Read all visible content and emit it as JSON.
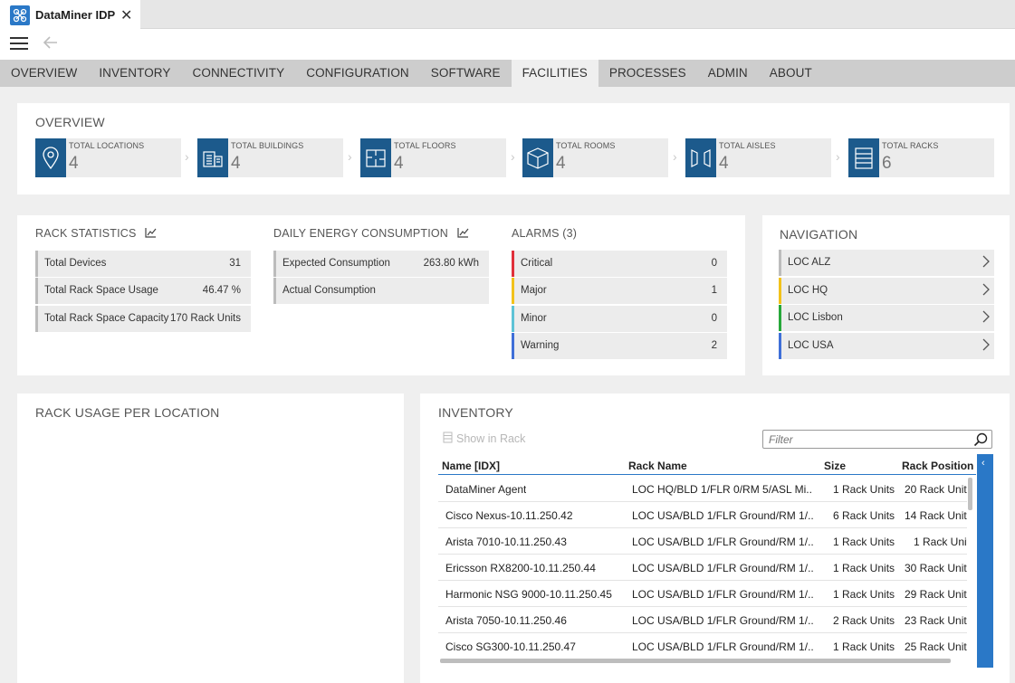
{
  "window": {
    "title": "DataMiner IDP"
  },
  "nav": {
    "tabs": [
      {
        "label": "OVERVIEW"
      },
      {
        "label": "INVENTORY"
      },
      {
        "label": "CONNECTIVITY"
      },
      {
        "label": "CONFIGURATION"
      },
      {
        "label": "SOFTWARE"
      },
      {
        "label": "FACILITIES",
        "active": true
      },
      {
        "label": "PROCESSES"
      },
      {
        "label": "ADMIN"
      },
      {
        "label": "ABOUT"
      }
    ]
  },
  "overview": {
    "title": "OVERVIEW",
    "cards": [
      {
        "label": "TOTAL LOCATIONS",
        "value": "4",
        "icon": "location-pin-icon"
      },
      {
        "label": "TOTAL BUILDINGS",
        "value": "4",
        "icon": "building-icon"
      },
      {
        "label": "TOTAL FLOORS",
        "value": "4",
        "icon": "floor-plan-icon"
      },
      {
        "label": "TOTAL ROOMS",
        "value": "4",
        "icon": "room-cube-icon"
      },
      {
        "label": "TOTAL AISLES",
        "value": "4",
        "icon": "aisle-icon"
      },
      {
        "label": "TOTAL RACKS",
        "value": "6",
        "icon": "rack-icon"
      }
    ]
  },
  "rack_statistics": {
    "title": "RACK STATISTICS",
    "rows": [
      {
        "label": "Total Devices",
        "value": "31"
      },
      {
        "label": "Total Rack Space Usage",
        "value": "46.47 %"
      },
      {
        "label": "Total Rack Space Capacity",
        "value": "170 Rack Units"
      }
    ]
  },
  "energy": {
    "title": "DAILY ENERGY CONSUMPTION",
    "rows": [
      {
        "label": "Expected Consumption",
        "value": "263.80 kWh"
      },
      {
        "label": "Actual Consumption",
        "value": ""
      }
    ]
  },
  "alarms": {
    "title": "ALARMS (3)",
    "rows": [
      {
        "label": "Critical",
        "value": "0",
        "color": "#e0303a"
      },
      {
        "label": "Major",
        "value": "1",
        "color": "#f2c21b"
      },
      {
        "label": "Minor",
        "value": "0",
        "color": "#5ec3d6"
      },
      {
        "label": "Warning",
        "value": "2",
        "color": "#3f6fd8"
      }
    ]
  },
  "navigation": {
    "title": "NAVIGATION",
    "items": [
      {
        "label": "LOC ALZ",
        "color": "#bcbcbc"
      },
      {
        "label": "LOC HQ",
        "color": "#f2c21b"
      },
      {
        "label": "LOC Lisbon",
        "color": "#27a83a"
      },
      {
        "label": "LOC USA",
        "color": "#3f6fd8"
      }
    ]
  },
  "rack_usage": {
    "title": "RACK USAGE PER LOCATION"
  },
  "inventory": {
    "title": "INVENTORY",
    "show_in_rack_label": "Show in Rack",
    "filter_placeholder": "Filter",
    "columns": [
      "Name [IDX]",
      "Rack Name",
      "Size",
      "Rack Position"
    ],
    "rows": [
      [
        "DataMiner Agent",
        "LOC HQ/BLD 1/FLR 0/RM 5/ASL Mi...",
        "1 Rack Units",
        "20 Rack Unit"
      ],
      [
        "Cisco Nexus-10.11.250.42",
        "LOC USA/BLD 1/FLR Ground/RM 1/...",
        "6 Rack Units",
        "14 Rack Unit"
      ],
      [
        "Arista 7010-10.11.250.43",
        "LOC USA/BLD 1/FLR Ground/RM 1/...",
        "1 Rack Units",
        "1 Rack Unit"
      ],
      [
        "Ericsson RX8200-10.11.250.44",
        "LOC USA/BLD 1/FLR Ground/RM 1/...",
        "1 Rack Units",
        "30 Rack Unit"
      ],
      [
        "Harmonic NSG 9000-10.11.250.45",
        "LOC USA/BLD 1/FLR Ground/RM 1/...",
        "1 Rack Units",
        "29 Rack Unit"
      ],
      [
        "Arista 7050-10.11.250.46",
        "LOC USA/BLD 1/FLR Ground/RM 1/...",
        "2 Rack Units",
        "23 Rack Unit"
      ],
      [
        "Cisco SG300-10.11.250.47",
        "LOC USA/BLD 1/FLR Ground/RM 1/...",
        "1 Rack Units",
        "25 Rack Unit"
      ]
    ]
  },
  "colors": {
    "accent": "#2a78c7",
    "icon_tile": "#1c5a8c"
  }
}
